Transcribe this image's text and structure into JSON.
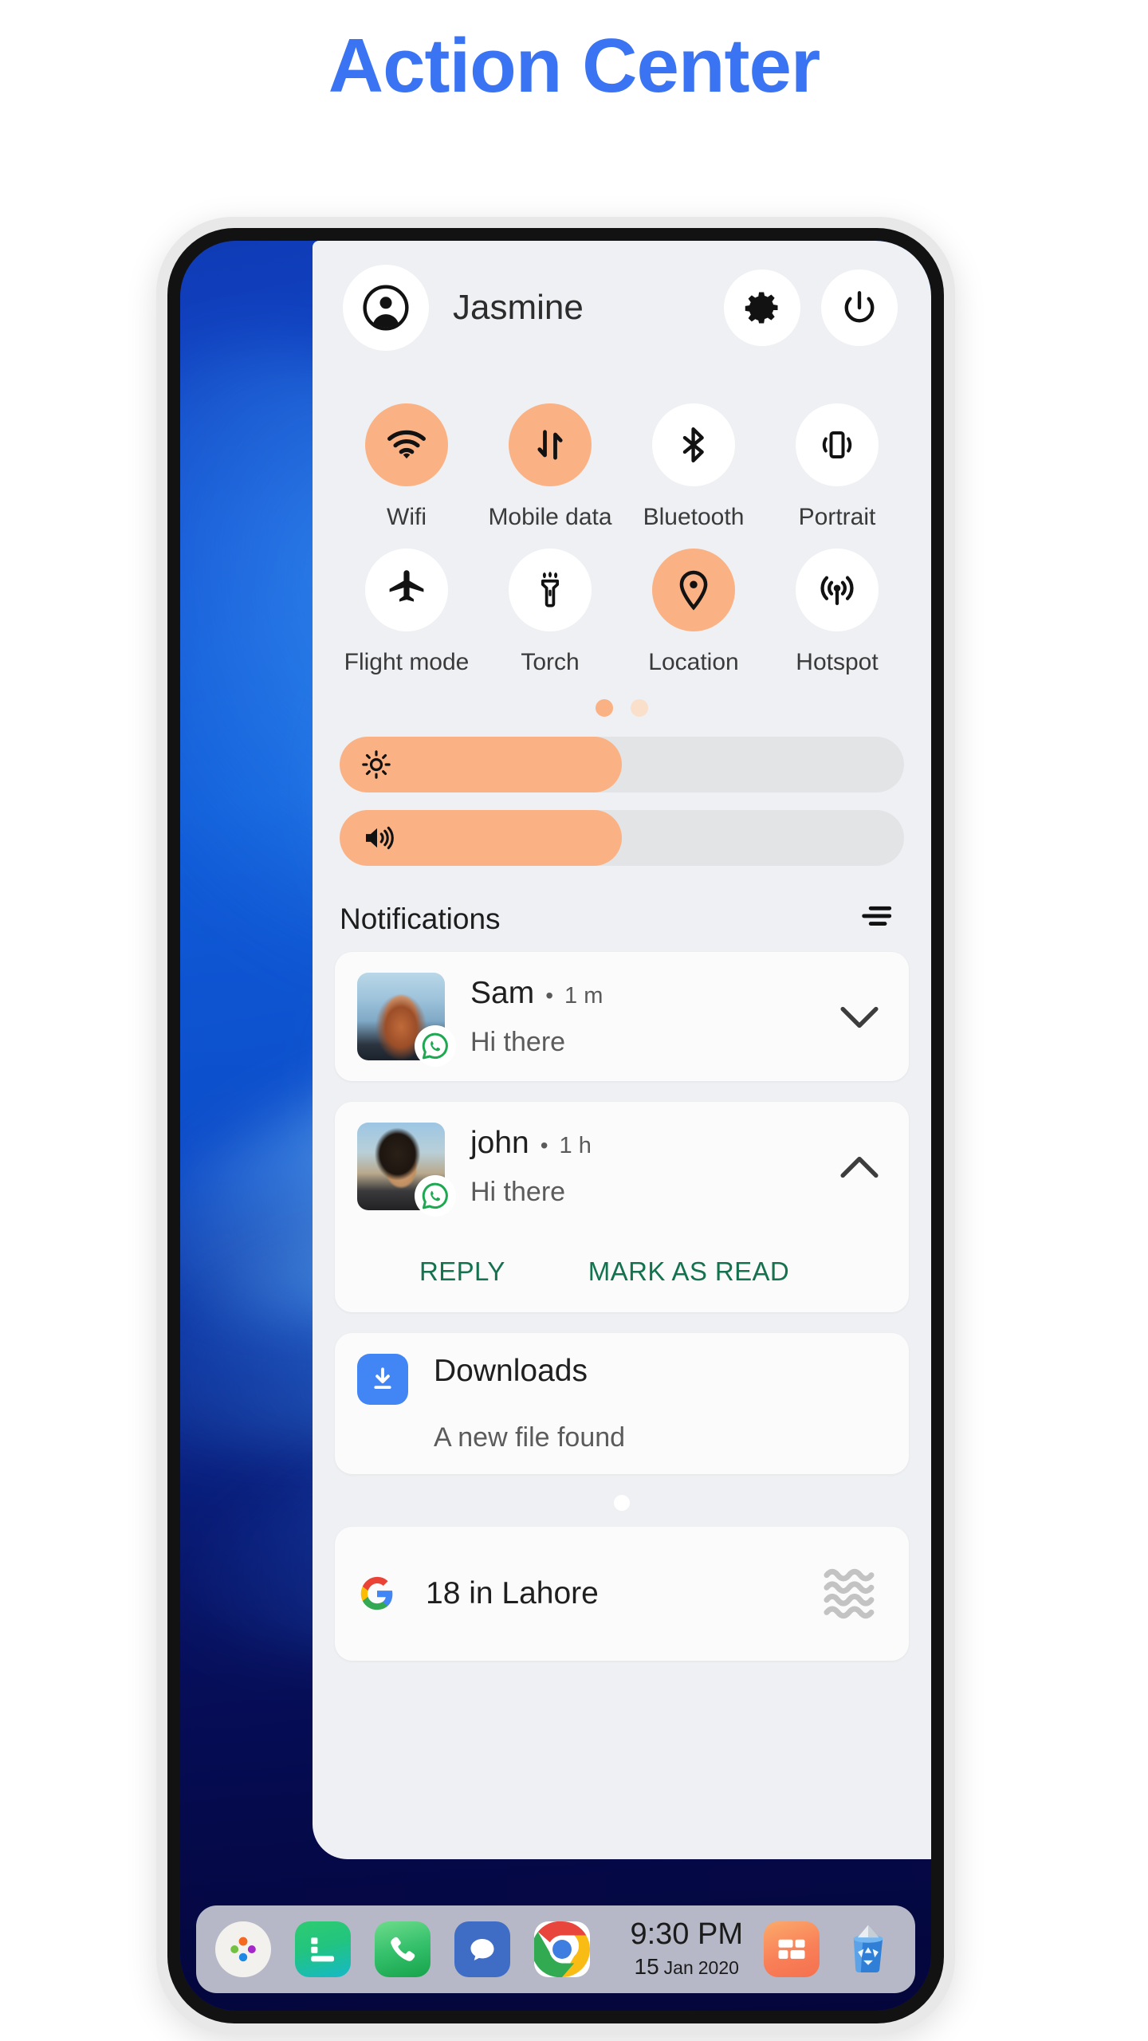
{
  "page": {
    "title": "Action Center"
  },
  "colors": {
    "title_blue": "#3b74f2",
    "accent_orange": "#fab183",
    "panel_bg": "#eef0f3",
    "card_bg": "#fbfbfb",
    "action_green": "#14724f",
    "downloads_blue": "#4285f4"
  },
  "header": {
    "avatar_icon": "account-circle-icon",
    "user_name": "Jasmine",
    "settings_icon": "gear-icon",
    "power_icon": "power-icon"
  },
  "toggles": {
    "rows": [
      [
        {
          "label": "Wifi",
          "icon": "wifi-icon",
          "active": true
        },
        {
          "label": "Mobile data",
          "icon": "mobile-data-icon",
          "active": true
        },
        {
          "label": "Bluetooth",
          "icon": "bluetooth-icon",
          "active": false
        },
        {
          "label": "Portrait",
          "icon": "portrait-icon",
          "active": false
        }
      ],
      [
        {
          "label": "Flight mode",
          "icon": "airplane-icon",
          "active": false
        },
        {
          "label": "Torch",
          "icon": "flashlight-icon",
          "active": false
        },
        {
          "label": "Location",
          "icon": "location-pin-icon",
          "active": true
        },
        {
          "label": "Hotspot",
          "icon": "hotspot-icon",
          "active": false
        }
      ]
    ],
    "page_dots": {
      "count": 2,
      "active_index": 0
    }
  },
  "sliders": [
    {
      "name": "brightness",
      "icon": "brightness-sun-icon",
      "value_percent": 50
    },
    {
      "name": "volume",
      "icon": "volume-speaker-icon",
      "value_percent": 50
    }
  ],
  "notifications_section": {
    "title": "Notifications",
    "menu_icon": "notification-settings-icon"
  },
  "notifications": [
    {
      "id": "sam",
      "type": "message",
      "sender": "Sam",
      "separator": "•",
      "time": "1 m",
      "message": "Hi there",
      "app_badge_icon": "whatsapp-icon",
      "avatar_kind": "photo-woman",
      "expanded": false,
      "chevron_icon": "chevron-down-icon",
      "actions": []
    },
    {
      "id": "john",
      "type": "message",
      "sender": "john",
      "separator": "•",
      "time": "1 h",
      "message": "Hi there",
      "app_badge_icon": "whatsapp-icon",
      "avatar_kind": "photo-man",
      "expanded": true,
      "chevron_icon": "chevron-up-icon",
      "actions": [
        "REPLY",
        "MARK AS READ"
      ]
    },
    {
      "id": "downloads",
      "type": "app",
      "title": "Downloads",
      "subtitle": "A new file found",
      "app_icon": "download-icon"
    },
    {
      "id": "google-weather",
      "type": "widget",
      "logo_icon": "google-g-icon",
      "text": "18 in Lahore",
      "weather_icon": "haze-waves-icon"
    }
  ],
  "dock": {
    "apps": [
      {
        "name": "app-drawer",
        "icon": "app-drawer-icon"
      },
      {
        "name": "notes",
        "icon": "notes-icon"
      },
      {
        "name": "phone",
        "icon": "phone-icon"
      },
      {
        "name": "messages",
        "icon": "messages-icon"
      },
      {
        "name": "chrome",
        "icon": "chrome-icon"
      }
    ],
    "clock": {
      "time": "9:30 PM",
      "day": "15",
      "month": "Jan",
      "year": "2020"
    },
    "tray": [
      {
        "name": "widgets",
        "icon": "widgets-grid-icon"
      },
      {
        "name": "recycle-bin",
        "icon": "recycle-bin-icon"
      }
    ]
  }
}
